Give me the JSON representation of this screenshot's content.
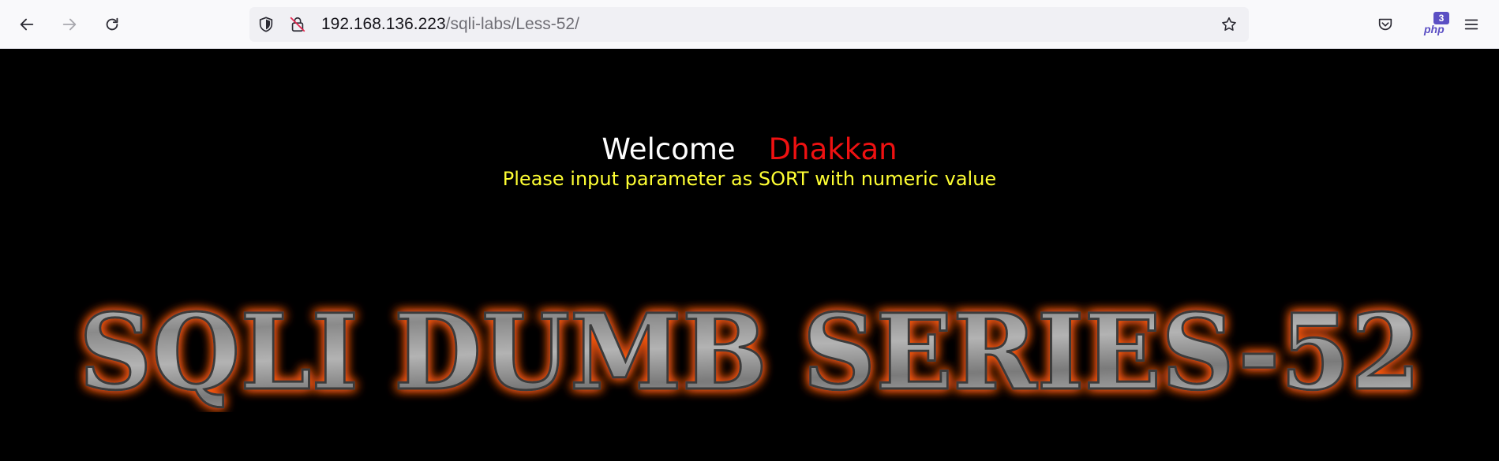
{
  "browser": {
    "url_host": "192.168.136.223",
    "url_path": "/sqli-labs/Less-52/",
    "icons": {
      "back": "back-arrow-icon",
      "forward": "forward-arrow-icon",
      "reload": "reload-icon",
      "tracking": "shield-icon",
      "security": "insecure-lock-icon",
      "bookmark": "star-icon",
      "pocket": "pocket-icon",
      "extension": "php-extension-icon",
      "menu": "hamburger-menu-icon"
    },
    "extension_badge": "3",
    "extension_label": "php"
  },
  "page": {
    "welcome": "Welcome",
    "name": "Dhakkan",
    "instruction": "Please input parameter as SORT with numeric value",
    "banner_text": "SQLI DUMB SERIES-52",
    "colors": {
      "background": "#000000",
      "welcome": "#ffffff",
      "name": "#ee1111",
      "instruction": "#ffff33",
      "banner_glow": "#ff5a14",
      "banner_metal": "#9a9a9a"
    }
  }
}
